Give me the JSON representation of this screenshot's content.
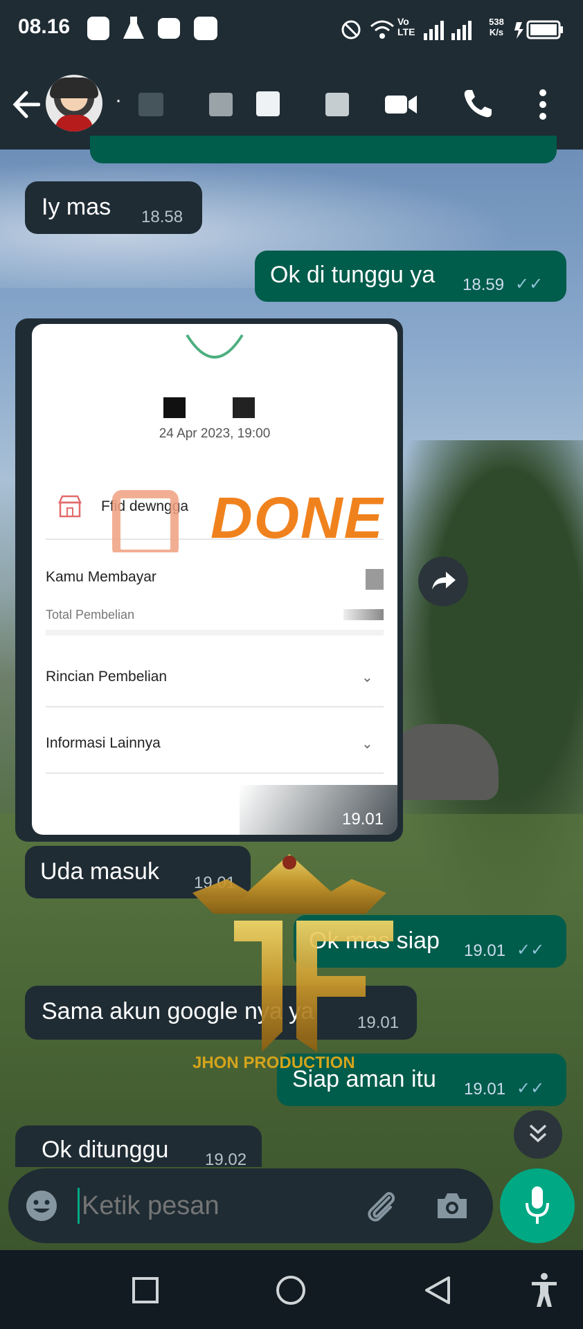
{
  "status_bar": {
    "time": "08.16",
    "network_speed_top": "538",
    "network_speed_bottom": "K/s",
    "volte": "Vo LTE"
  },
  "header": {
    "contact_name": "·"
  },
  "messages": [
    {
      "dir": "in",
      "text": "Iy mas",
      "time": "18.58"
    },
    {
      "dir": "out",
      "text": "Ok di tunggu ya",
      "time": "18.59"
    },
    {
      "dir": "out",
      "text": "Ok mas siap",
      "time": "19.01"
    },
    {
      "dir": "in",
      "text": "Uda masuk",
      "time": "19.01"
    },
    {
      "dir": "in",
      "text": "Sama akun google nya ya",
      "time": "19.01"
    },
    {
      "dir": "out",
      "text": "Siap aman itu",
      "time": "19.01"
    },
    {
      "dir": "in",
      "text": "Ok ditunggu",
      "time": "19.02"
    }
  ],
  "receipt": {
    "date": "24 Apr 2023, 19:00",
    "store_name": "Ffid dewngga",
    "overlay_text": "DONE",
    "paid_label": "Kamu Membayar",
    "total_label": "Total Pembelian",
    "details_label": "Rincian Pembelian",
    "other_info_label": "Informasi Lainnya",
    "time": "19.01"
  },
  "watermark": {
    "text": "JHON PRODUCTION"
  },
  "input": {
    "placeholder": "Ketik pesan"
  },
  "colors": {
    "header_bg": "#1f2c34",
    "incoming_bubble": "#1f2c34",
    "outgoing_bubble": "#005c4b",
    "accent": "#00a884",
    "done_orange": "#f0821e",
    "watermark_gold": "#d4a41c"
  }
}
